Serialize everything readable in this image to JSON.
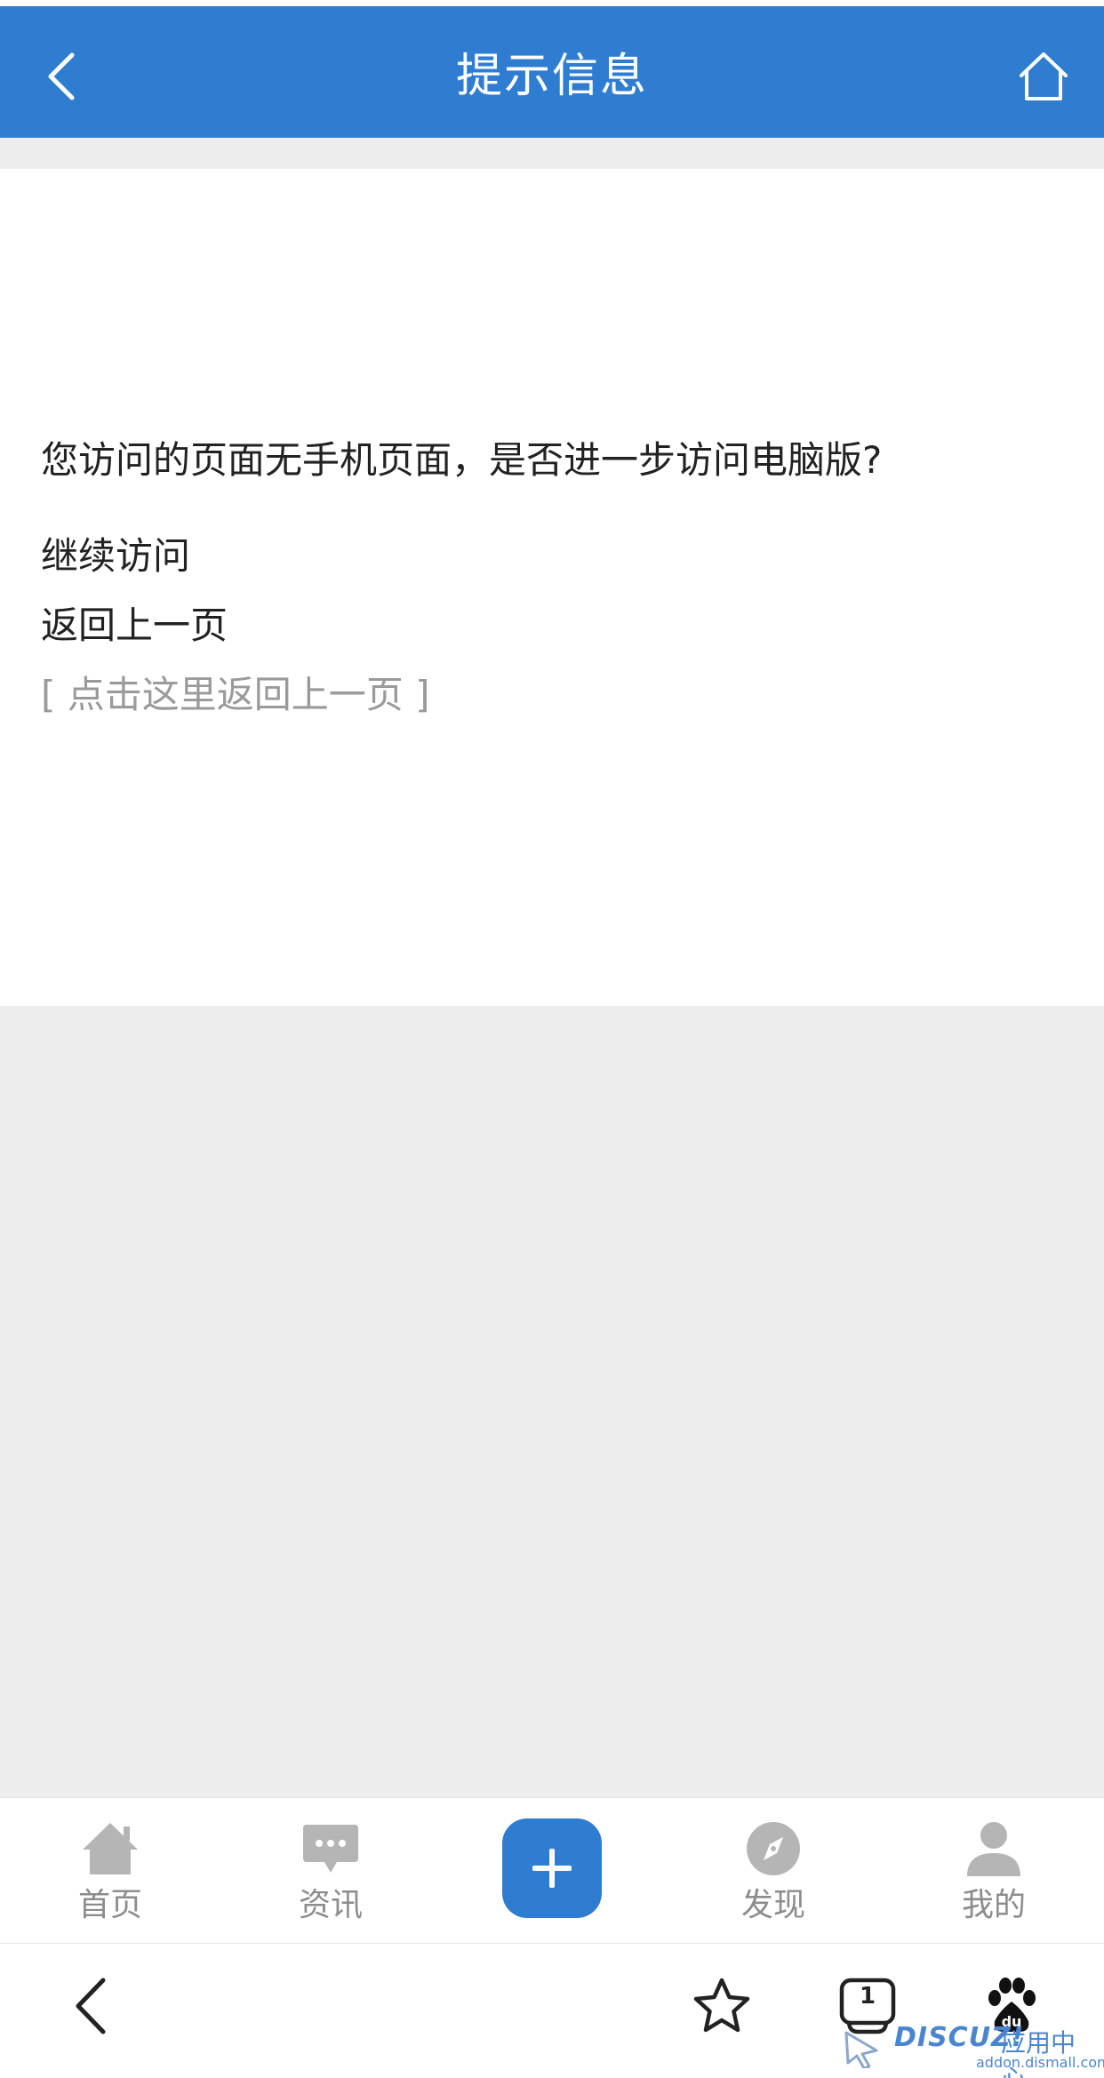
{
  "header": {
    "title": "提示信息",
    "back_icon": "chevron-left-icon",
    "home_icon": "home-icon",
    "background_color": "#2f7dd1"
  },
  "main": {
    "message": "您访问的页面无手机页面，是否进一步访问电脑版?",
    "continue_link": "继续访问",
    "back_link": "返回上一页",
    "back_hint": "[ 点击这里返回上一页 ]"
  },
  "tabbar": {
    "items": [
      {
        "label": "首页",
        "icon": "home-icon"
      },
      {
        "label": "资讯",
        "icon": "chat-bubble-icon"
      },
      {
        "label": "",
        "icon": "plus-icon"
      },
      {
        "label": "发现",
        "icon": "compass-icon"
      },
      {
        "label": "我的",
        "icon": "user-icon"
      }
    ],
    "accent_color": "#2f7dd1"
  },
  "browser_bar": {
    "back_icon": "chevron-left-icon",
    "bookmark_icon": "star-icon",
    "tabs_icon": "tabs-icon",
    "tabs_count": "1",
    "baidu_icon": "paw-icon"
  },
  "watermark": {
    "brand": "DISCUZ!",
    "cn": "应用中心",
    "domain": "addon.dismall.com"
  }
}
